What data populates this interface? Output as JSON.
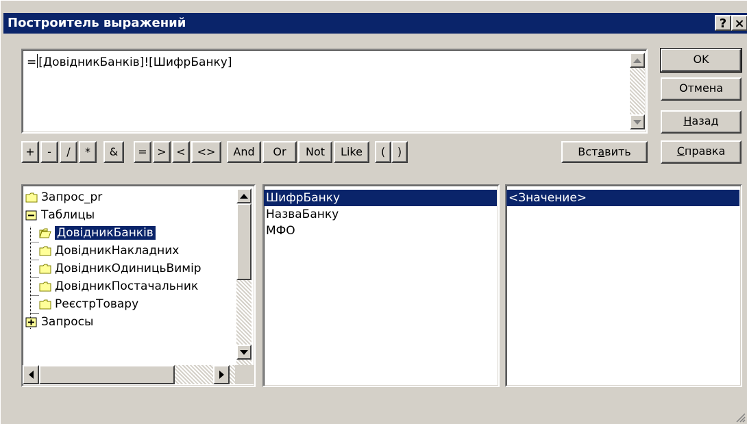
{
  "window": {
    "title": "Построитель выражений",
    "help_glyph": "?",
    "close_glyph": "×"
  },
  "expression": {
    "prefix": "=",
    "value": "[ДовідникБанків]![ШифрБанку]"
  },
  "buttons": {
    "ok": "OK",
    "cancel": "Отмена",
    "back_pre": "",
    "back_acc": "Н",
    "back_post": "азад",
    "insert_pre": "Вст",
    "insert_acc": "а",
    "insert_post": "вить",
    "help_pre": "",
    "help_acc": "С",
    "help_post": "правка"
  },
  "operators": [
    "+",
    "-",
    "/",
    "*",
    "&",
    "=",
    ">",
    "<",
    "<>",
    "And",
    "Or",
    "Not",
    "Like",
    "(",
    ")"
  ],
  "tree": {
    "items": [
      {
        "label": "Запрос_pr",
        "icon": "folder-icon"
      },
      {
        "label": "Таблицы",
        "icon": "minus-box-icon"
      },
      {
        "label": "ДовідникБанків",
        "icon": "open-folder-icon"
      },
      {
        "label": "ДовідникНакладних",
        "icon": "folder-icon"
      },
      {
        "label": "ДовідникОдиницьВимір",
        "icon": "folder-icon"
      },
      {
        "label": "ДовідникПостачальник",
        "icon": "folder-icon"
      },
      {
        "label": "РеєстрТовару",
        "icon": "folder-icon"
      },
      {
        "label": "Запросы",
        "icon": "plus-box-icon"
      }
    ]
  },
  "fields": {
    "items": [
      "ШифрБанку",
      "НазваБанку",
      "МФО"
    ]
  },
  "values": {
    "items": [
      "<Значение>"
    ]
  },
  "colors": {
    "titlebar": "#0a246a",
    "selection": "#0a246a",
    "face": "#d4d0c8",
    "folder": "#ffff99"
  }
}
